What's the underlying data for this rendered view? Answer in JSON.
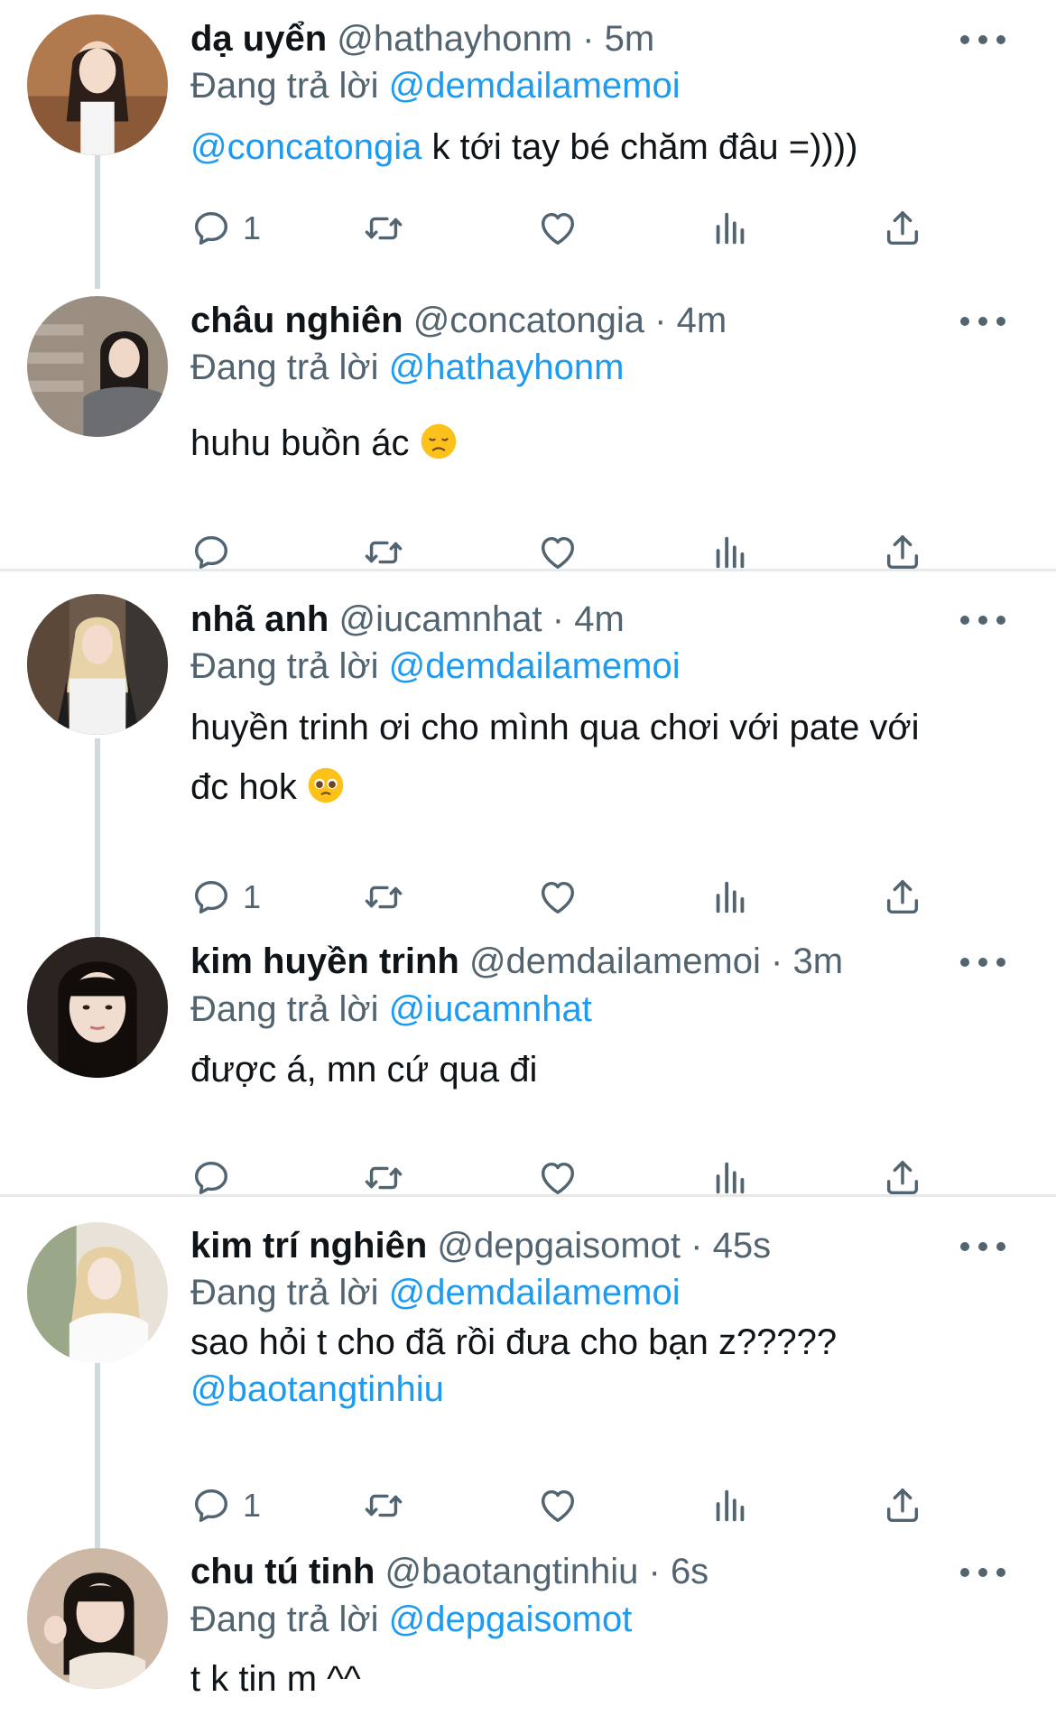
{
  "colors": {
    "mention": "#1d9bf0",
    "secondary": "#536471",
    "divider": "#e7e9ea"
  },
  "tweets": [
    {
      "name": "dạ uyển",
      "handle": "@hathayhonm",
      "time": "5m",
      "replying_label": "Đang trả lời",
      "replying_to": "@demdailamemoi",
      "body_mention": "@concatongia",
      "body_text": " k tới tay bé chăm đâu =))))",
      "reply_count": "1"
    },
    {
      "name": "châu nghiên",
      "handle": "@concatongia",
      "time": "4m",
      "replying_label": "Đang trả lời",
      "replying_to": "@hathayhonm",
      "body_text": "huhu buồn ác",
      "body_emoji": "disappointed-face-emoji",
      "reply_count": ""
    },
    {
      "name": "nhã anh",
      "handle": "@iucamnhat",
      "time": "4m",
      "replying_label": "Đang trả lời",
      "replying_to": "@demdailamemoi",
      "body_text": "huyền trinh ơi cho mình qua chơi với pate với",
      "body_text2": "đc hok",
      "body_emoji": "pleading-face-emoji",
      "reply_count": "1"
    },
    {
      "name": "kim huyền trinh",
      "handle": "@demdailamemoi",
      "time": "3m",
      "replying_label": "Đang trả lời",
      "replying_to": "@iucamnhat",
      "body_text": "được á, mn cứ qua đi",
      "reply_count": ""
    },
    {
      "name": "kim trí nghiên",
      "handle": "@depgaisomot",
      "time": "45s",
      "replying_label": "Đang trả lời",
      "replying_to": "@demdailamemoi",
      "body_text": "sao hỏi t cho đã rồi đưa cho bạn z?????",
      "body_mention": "@baotangtinhiu",
      "reply_count": "1"
    },
    {
      "name": "chu tú tinh",
      "handle": "@baotangtinhiu",
      "time": "6s",
      "replying_label": "Đang trả lời",
      "replying_to": "@depgaisomot",
      "body_text": "t k tin m ^^"
    }
  ],
  "separator": "·",
  "icons": {
    "reply": "reply-icon",
    "retweet": "retweet-icon",
    "like": "heart-icon",
    "views": "analytics-icon",
    "share": "share-icon",
    "more": "more-icon"
  }
}
